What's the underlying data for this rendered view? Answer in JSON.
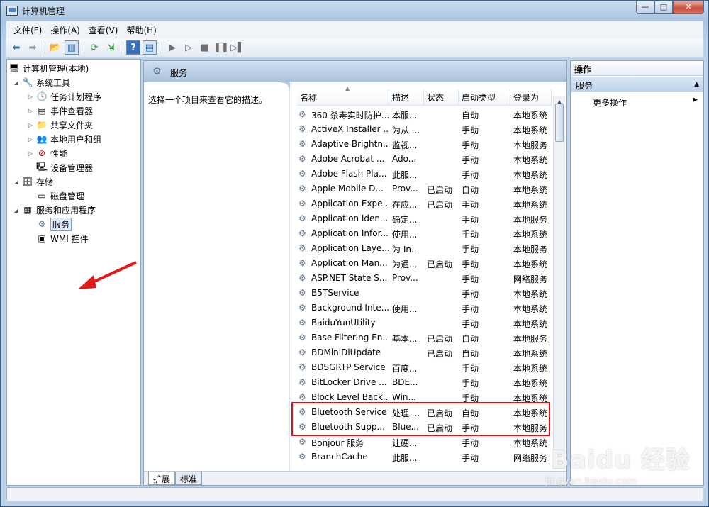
{
  "window": {
    "title": "计算机管理",
    "min": "—",
    "max": "□",
    "close": "✕"
  },
  "menu": [
    "文件(F)",
    "操作(A)",
    "查看(V)",
    "帮助(H)"
  ],
  "tree": [
    {
      "label": "计算机管理(本地)",
      "icon": "computer-icon",
      "glyph": "🖥",
      "twisty": ""
    },
    {
      "label": "系统工具",
      "icon": "tools-icon",
      "glyph": "🔧",
      "twisty": "◢"
    },
    {
      "label": "任务计划程序",
      "icon": "clock-icon",
      "glyph": "🕓",
      "twisty": "▷"
    },
    {
      "label": "事件查看器",
      "icon": "event-viewer-icon",
      "glyph": "▤",
      "twisty": "▷"
    },
    {
      "label": "共享文件夹",
      "icon": "shared-folder-icon",
      "glyph": "📁",
      "twisty": "▷"
    },
    {
      "label": "本地用户和组",
      "icon": "users-icon",
      "glyph": "👥",
      "twisty": "▷"
    },
    {
      "label": "性能",
      "icon": "performance-icon",
      "glyph": "⊘",
      "twisty": "▷"
    },
    {
      "label": "设备管理器",
      "icon": "device-manager-icon",
      "glyph": "🖳",
      "twisty": ""
    },
    {
      "label": "存储",
      "icon": "storage-icon",
      "glyph": "🗄",
      "twisty": "◢"
    },
    {
      "label": "磁盘管理",
      "icon": "disk-icon",
      "glyph": "▭",
      "twisty": ""
    },
    {
      "label": "服务和应用程序",
      "icon": "services-apps-icon",
      "glyph": "▦",
      "twisty": "◢"
    },
    {
      "label": "服务",
      "icon": "gear-icon",
      "glyph": "⚙",
      "twisty": ""
    },
    {
      "label": "WMI 控件",
      "icon": "wmi-icon",
      "glyph": "▣",
      "twisty": ""
    }
  ],
  "center": {
    "title": "服务",
    "description": "选择一个项目来查看它的描述。",
    "columns": [
      "名称",
      "描述",
      "状态",
      "启动类型",
      "登录为"
    ],
    "rows": [
      [
        "360 杀毒实时防护...",
        "本服...",
        "",
        "自动",
        "本地系统"
      ],
      [
        "ActiveX Installer ...",
        "为从 ...",
        "",
        "手动",
        "本地系统"
      ],
      [
        "Adaptive Brightn...",
        "监视...",
        "",
        "手动",
        "本地服务"
      ],
      [
        "Adobe Acrobat ...",
        "Ado...",
        "",
        "手动",
        "本地系统"
      ],
      [
        "Adobe Flash Pla...",
        "此服...",
        "",
        "手动",
        "本地系统"
      ],
      [
        "Apple Mobile D...",
        "Prov...",
        "已启动",
        "自动",
        "本地系统"
      ],
      [
        "Application Expe...",
        "在应...",
        "已启动",
        "手动",
        "本地系统"
      ],
      [
        "Application Iden...",
        "确定...",
        "",
        "手动",
        "本地服务"
      ],
      [
        "Application Infor...",
        "使用...",
        "",
        "手动",
        "本地系统"
      ],
      [
        "Application Laye...",
        "为 In...",
        "",
        "手动",
        "本地服务"
      ],
      [
        "Application Man...",
        "为通...",
        "已启动",
        "手动",
        "本地系统"
      ],
      [
        "ASP.NET State S...",
        "Prov...",
        "",
        "手动",
        "网络服务"
      ],
      [
        "B5TService",
        "",
        "",
        "手动",
        "本地系统"
      ],
      [
        "Background Inte...",
        "使用...",
        "",
        "手动",
        "本地系统"
      ],
      [
        "BaiduYunUtility",
        "",
        "",
        "手动",
        "本地系统"
      ],
      [
        "Base Filtering En...",
        "基本...",
        "已启动",
        "自动",
        "本地服务"
      ],
      [
        "BDMiniDlUpdate",
        "",
        "已启动",
        "自动",
        "本地系统"
      ],
      [
        "BDSGRTP Service",
        "百度...",
        "",
        "手动",
        "本地系统"
      ],
      [
        "BitLocker Drive ...",
        "BDE...",
        "",
        "手动",
        "本地系统"
      ],
      [
        "Block Level Back...",
        "Win...",
        "",
        "手动",
        "本地系统"
      ],
      [
        "Bluetooth Service",
        "处理 ...",
        "已启动",
        "自动",
        "本地系统"
      ],
      [
        "Bluetooth Supp...",
        "Blue...",
        "已启动",
        "手动",
        "本地服务"
      ],
      [
        "Bonjour 服务",
        "让硬...",
        "",
        "手动",
        "本地系统"
      ],
      [
        "BranchCache",
        "此服...",
        "",
        "手动",
        "网络服务"
      ]
    ],
    "tabs": [
      "扩展",
      "标准"
    ]
  },
  "actions": {
    "header": "操作",
    "group": "服务",
    "more": "更多操作"
  },
  "watermark": {
    "main": "Baidu 经验",
    "sub": "jingyan.baidu.com"
  }
}
